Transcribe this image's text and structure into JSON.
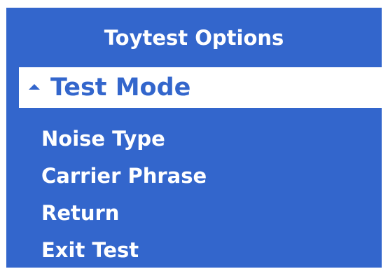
{
  "menu": {
    "title": "Toytest Options",
    "selected": {
      "label": "Test Mode",
      "icon": "up-arrow-icon"
    },
    "items": [
      {
        "label": "Noise Type"
      },
      {
        "label": "Carrier Phrase"
      },
      {
        "label": "Return"
      },
      {
        "label": "Exit Test"
      }
    ]
  },
  "colors": {
    "panel_background": "#3366cc",
    "text": "#ffffff",
    "highlight_background": "#ffffff",
    "highlight_text": "#3366cc"
  }
}
